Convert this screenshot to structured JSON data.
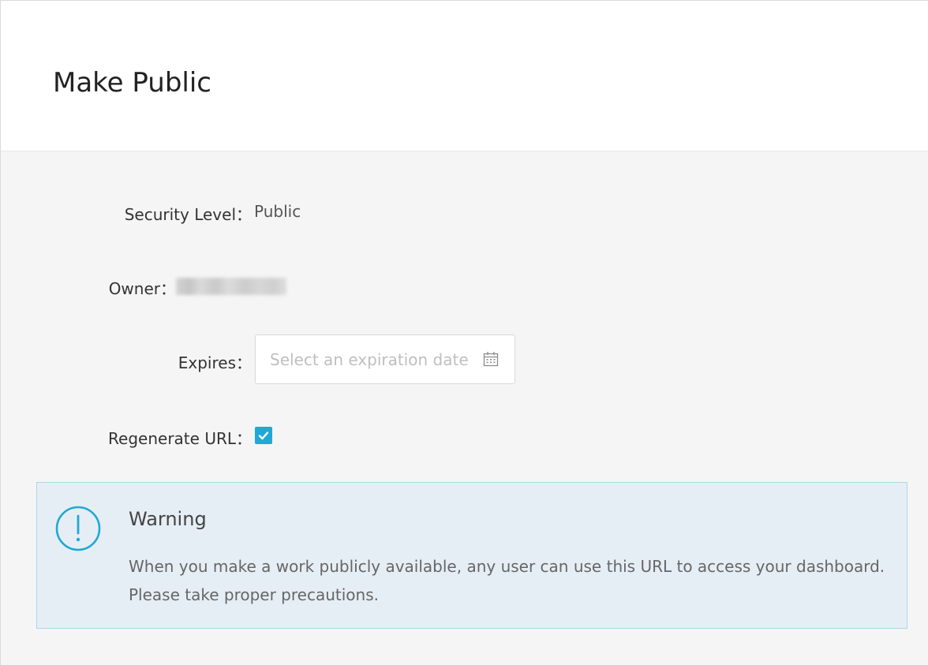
{
  "dialog": {
    "title": "Make Public"
  },
  "form": {
    "security_level": {
      "label": "Security Level：",
      "value": "Public"
    },
    "owner": {
      "label": "Owner："
    },
    "expires": {
      "label": "Expires：",
      "placeholder": "Select an expiration date",
      "icon": "calendar-icon"
    },
    "regenerate_url": {
      "label": "Regenerate URL：",
      "checked": true
    }
  },
  "alert": {
    "icon": "exclamation-circle-icon",
    "title": "Warning",
    "body": "When you make a work publicly available, any user can use this URL to access your dashboard. Please take proper precautions."
  },
  "colors": {
    "accent": "#1fa9d6",
    "alert_bg": "#e6eef5",
    "alert_border": "#a8d8ec"
  }
}
